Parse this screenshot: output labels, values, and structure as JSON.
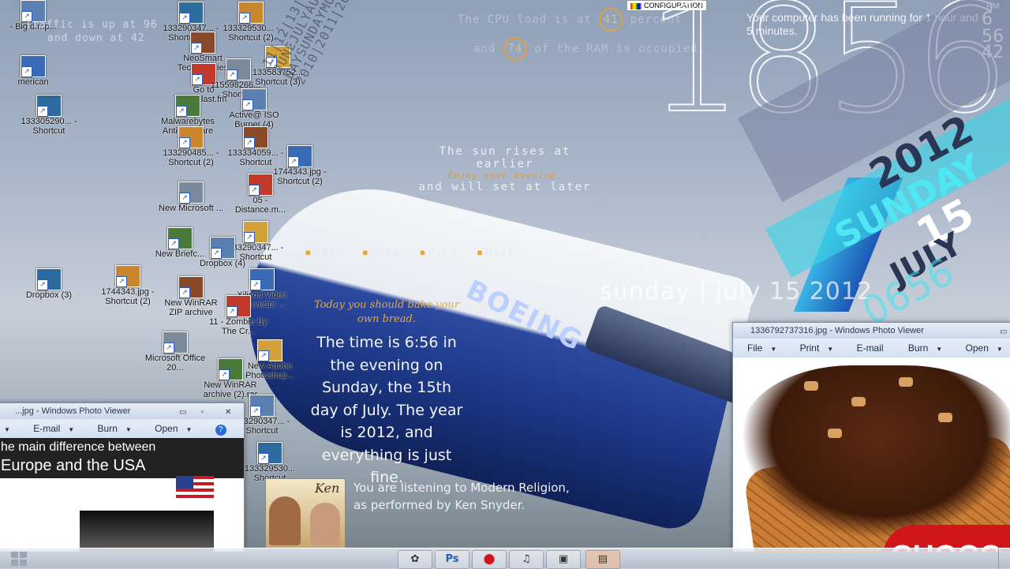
{
  "colors": {
    "accent_orange": "#e7a53a",
    "calendar_cyan": "#4fe7f3",
    "calendar_navy": "#2b3554",
    "taskbar": "#d4dbe6"
  },
  "config_badge": "CONFIGURATION",
  "traffic": {
    "line1": "Traffic is up at 96",
    "line2": "and down at 42"
  },
  "cpu": {
    "prefix": "The CPU load is at",
    "value": "41",
    "suffix": "percent"
  },
  "ram": {
    "prefix": "and",
    "value": "74",
    "suffix": "of the RAM is occupied."
  },
  "clock": {
    "time": "1856",
    "ampm": "PM",
    "h": "6",
    "m": "56",
    "s": "42"
  },
  "uptime": "Your computer has been running for 1 hour and 5 minutes.",
  "vertical_dates": [
    "11|12|13|14|15|16|17|18",
    "JUNEJULYAUG",
    "DAYSUNDAYMON",
    "2010|2011|2012|2013|2014|2015"
  ],
  "sun": {
    "line1": "The sun rises at earlier",
    "line2": "Enjoy your evening.",
    "line3": "and will set at later"
  },
  "links": [
    "Rain",
    "Docs",
    "Pics",
    "Msic"
  ],
  "date_line": "sunday | july 15 2012",
  "bake": "Today you should bake your own bread.",
  "narration": "The time is 6:56 in the evening on Sunday, the 15th day of July. The year is 2012, and everything is just fine.",
  "listening": {
    "line1": "You are listening to Modern Religion,",
    "line2": "as performed by Ken Snyder."
  },
  "album": {
    "title": "Ken"
  },
  "calendar": {
    "year": "2012",
    "day": "SUNDAY",
    "num": "15",
    "month": "JULY",
    "ghost": "0656"
  },
  "desktop_icons": [
    {
      "label": "- Big d.mp...",
      "kind": "img"
    },
    {
      "label": "133290347... - Shortcut (2)",
      "kind": "img"
    },
    {
      "label": "133329530... - Shortcut (2)",
      "kind": "img"
    },
    {
      "label": "NeoSmart Technologies",
      "kind": "img"
    },
    {
      "label": "merican",
      "kind": "img"
    },
    {
      "label": "Go to www.last.fm",
      "kind": "img"
    },
    {
      "label": "115598266... - Shortcut",
      "kind": "img"
    },
    {
      "label": "133583752... Shortcut (3)",
      "kind": "img"
    },
    {
      "label": "Malwarebytes Anti-Malware",
      "kind": "img"
    },
    {
      "label": "Active@ ISO Burner (4)",
      "kind": "img"
    },
    {
      "label": "133305290... - Shortcut",
      "kind": "img"
    },
    {
      "label": "133290485... - Shortcut (2)",
      "kind": "img"
    },
    {
      "label": "133334059... - Shortcut",
      "kind": "img"
    },
    {
      "label": "1744343.jpg - Shortcut (2)",
      "kind": "img"
    },
    {
      "label": "05 - Distance.m...",
      "kind": "img"
    },
    {
      "label": "New Microsoft ...",
      "kind": "img"
    },
    {
      "label": "133290347... - Shortcut",
      "kind": "img"
    },
    {
      "label": "New Briefc...",
      "kind": "img"
    },
    {
      "label": "Dropbox (4)",
      "kind": "img"
    },
    {
      "label": "Dropbox (3)",
      "kind": "img"
    },
    {
      "label": "1744343.jpg - Shortcut (2)",
      "kind": "img"
    },
    {
      "label": "New WinRAR ZIP archive",
      "kind": "img"
    },
    {
      "label": "Xilisoft Video Converter ...",
      "kind": "img"
    },
    {
      "label": "11 - Zombie By The Cr...",
      "kind": "img"
    },
    {
      "label": "Microsoft Office 20...",
      "kind": "img"
    },
    {
      "label": "New Adobe Photoshop...",
      "kind": "img"
    },
    {
      "label": "New WinRAR archive (2).rar",
      "kind": "img"
    },
    {
      "label": "133290347... - Shortcut",
      "kind": "img"
    },
    {
      "label": "133329530... Shortcut",
      "kind": "img"
    }
  ],
  "viewer1": {
    "title": "1336792737316.jpg - Windows Photo Viewer",
    "menu": [
      "File",
      "Print",
      "E-mail",
      "Burn",
      "Open"
    ],
    "logo": "CHOCO"
  },
  "viewer2": {
    "title": "...jpg - Windows Photo Viewer",
    "menu": [
      "E-mail",
      "Burn",
      "Open"
    ],
    "help": "?",
    "headline1": "he main difference between",
    "headline2": "Europe and the USA"
  },
  "taskbar": {
    "buttons": [
      {
        "icon": "media-icon",
        "glyph": "✿"
      },
      {
        "icon": "photoshop-icon",
        "glyph": "Ps"
      },
      {
        "icon": "opera-icon",
        "glyph": "⬤"
      },
      {
        "icon": "itunes-icon",
        "glyph": "♫"
      },
      {
        "icon": "terminal-icon",
        "glyph": "▣"
      },
      {
        "icon": "photo-viewer-icon",
        "glyph": "▤"
      }
    ]
  }
}
